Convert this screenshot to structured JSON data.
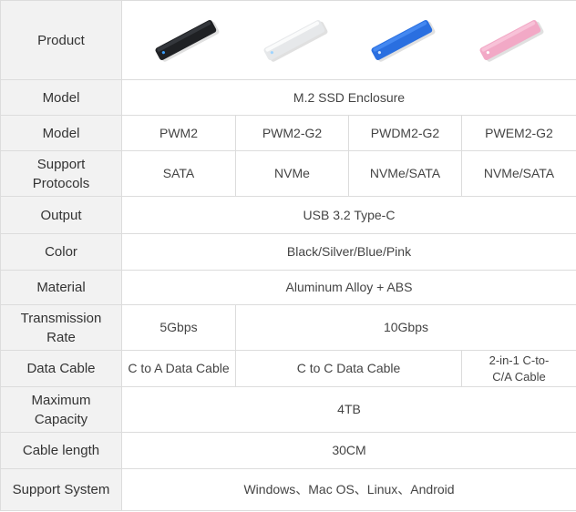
{
  "labels": {
    "product": "Product",
    "model_type": "Model",
    "model": "Model",
    "protocols_line1": "Support",
    "protocols_line2": "Protocols",
    "output": "Output",
    "color": "Color",
    "material": "Material",
    "rate_line1": "Transmission",
    "rate_line2": "Rate",
    "cable": "Data Cable",
    "capacity_line1": "Maximum",
    "capacity_line2": "Capacity",
    "cable_length": "Cable length",
    "system": "Support System"
  },
  "products": [
    {
      "name": "black-enclosure",
      "color": "#1f2124",
      "accent": "#3a3d42",
      "light": "#3aa0ff"
    },
    {
      "name": "silver-enclosure",
      "color": "#e6e8ea",
      "accent": "#ffffff",
      "light": "#9fd4ff"
    },
    {
      "name": "blue-enclosure",
      "color": "#2a6fe0",
      "accent": "#4b8ef5",
      "light": "#cfe6ff"
    },
    {
      "name": "pink-enclosure",
      "color": "#f2a9c6",
      "accent": "#f9c8dc",
      "light": "#ffffff"
    }
  ],
  "model_type": "M.2 SSD Enclosure",
  "models": [
    "PWM2",
    "PWM2-G2",
    "PWDM2-G2",
    "PWEM2-G2"
  ],
  "protocols": [
    "SATA",
    "NVMe",
    "NVMe/SATA",
    "NVMe/SATA"
  ],
  "output": "USB 3.2 Type-C",
  "color": "Black/Silver/Blue/Pink",
  "material": "Aluminum Alloy + ABS",
  "rates": [
    "5Gbps",
    "10Gbps"
  ],
  "cables": {
    "a": "C to A Data Cable",
    "c": "C to C Data Cable",
    "combo_line1": "2-in-1 C-to-",
    "combo_line2": "C/A Cable"
  },
  "capacity": "4TB",
  "cable_length": "30CM",
  "system": "Windows、Mac OS、Linux、Android"
}
